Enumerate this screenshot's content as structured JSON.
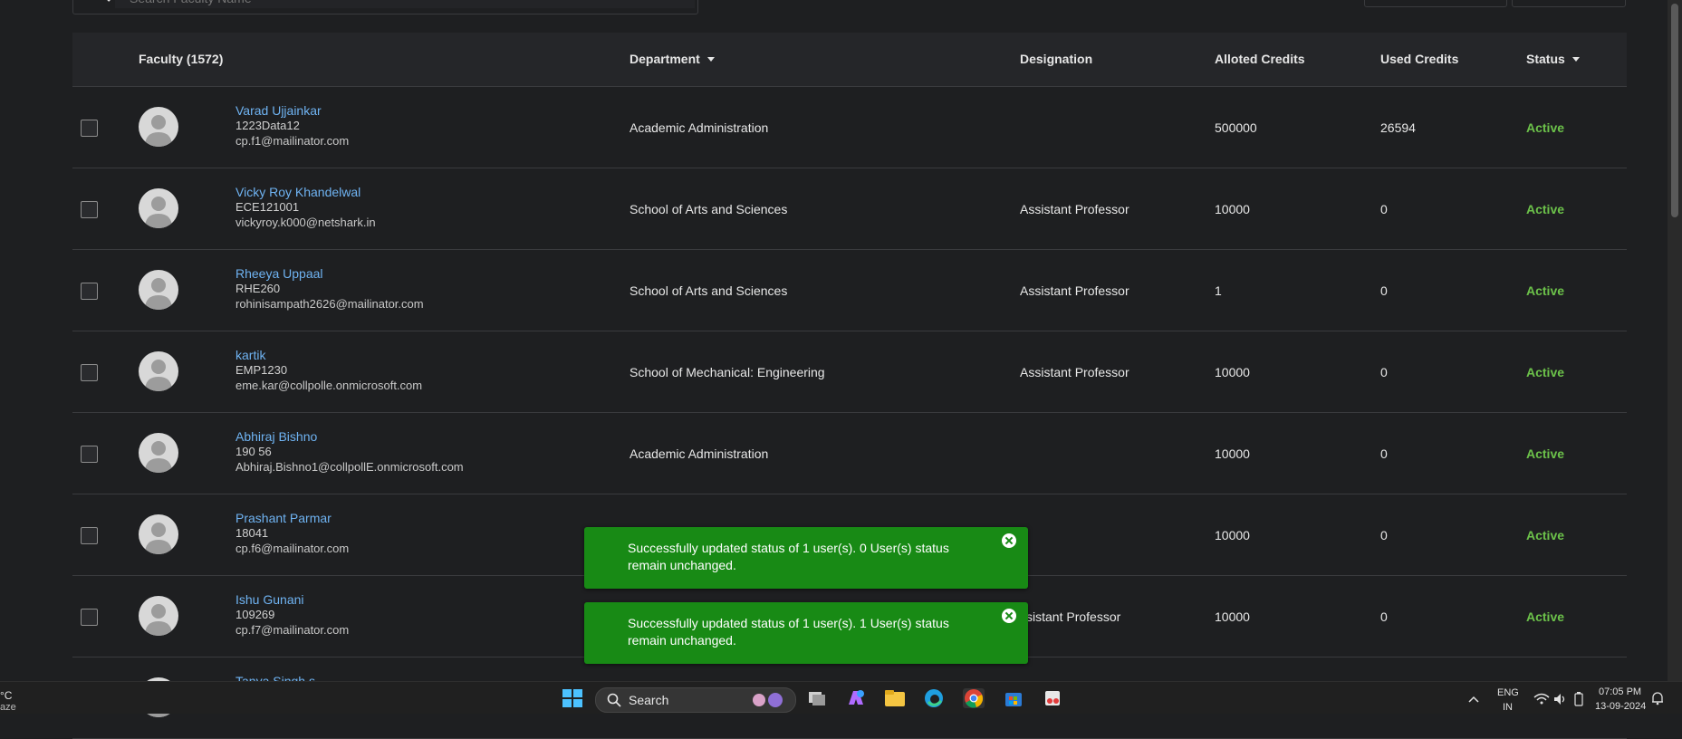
{
  "search": {
    "placeholder": "Search Faculty Name"
  },
  "table": {
    "headers": {
      "faculty": "Faculty (1572)",
      "department": "Department",
      "designation": "Designation",
      "alloted_credits": "Alloted Credits",
      "used_credits": "Used Credits",
      "status": "Status"
    },
    "rows": [
      {
        "name": "Varad Ujjainkar",
        "code": "1223Data12",
        "email": "cp.f1@mailinator.com",
        "department": "Academic Administration",
        "designation": "",
        "alloted": "500000",
        "used": "26594",
        "status": "Active"
      },
      {
        "name": "Vicky Roy Khandelwal",
        "code": "ECE121001",
        "email": "vickyroy.k000@netshark.in",
        "department": "School of Arts and Sciences",
        "designation": "Assistant Professor",
        "alloted": "10000",
        "used": "0",
        "status": "Active"
      },
      {
        "name": "Rheeya Uppaal",
        "code": "RHE260",
        "email": "rohinisampath2626@mailinator.com",
        "department": "School of Arts and Sciences",
        "designation": "Assistant Professor",
        "alloted": "1",
        "used": "0",
        "status": "Active"
      },
      {
        "name": "kartik",
        "code": "EMP1230",
        "email": "eme.kar@collpolle.onmicrosoft.com",
        "department": "School of Mechanical: Engineering",
        "designation": "Assistant Professor",
        "alloted": "10000",
        "used": "0",
        "status": "Active"
      },
      {
        "name": "Abhiraj Bishno",
        "code": "190 56",
        "email": "Abhiraj.Bishno1@collpollE.onmicrosoft.com",
        "department": "Academic Administration",
        "designation": "",
        "alloted": "10000",
        "used": "0",
        "status": "Active"
      },
      {
        "name": "Prashant Parmar",
        "code": "18041",
        "email": "cp.f6@mailinator.com",
        "department": "",
        "designation": "",
        "alloted": "10000",
        "used": "0",
        "status": "Active"
      },
      {
        "name": "Ishu Gunani",
        "code": "109269",
        "email": "cp.f7@mailinator.com",
        "department": "",
        "designation": "ssistant Professor",
        "alloted": "10000",
        "used": "0",
        "status": "Active"
      },
      {
        "name": "Tanya Singh s",
        "code": "",
        "email": "",
        "department": "",
        "designation": "",
        "alloted": "",
        "used": "",
        "status": ""
      }
    ]
  },
  "toasts": [
    {
      "message": "Successfully updated status of 1 user(s). 0 User(s) status remain unchanged."
    },
    {
      "message": "Successfully updated status of 1 user(s). 1 User(s) status remain unchanged."
    }
  ],
  "taskbar": {
    "weather_temp": "°C",
    "weather_label": "aze",
    "search_label": "Search",
    "lang_top": "ENG",
    "lang_bottom": "IN",
    "time": "07:05 PM",
    "date": "13-09-2024"
  },
  "colors": {
    "accent_link": "#6fb3f2",
    "status_active": "#6cc24a",
    "toast_bg": "#188a15"
  }
}
